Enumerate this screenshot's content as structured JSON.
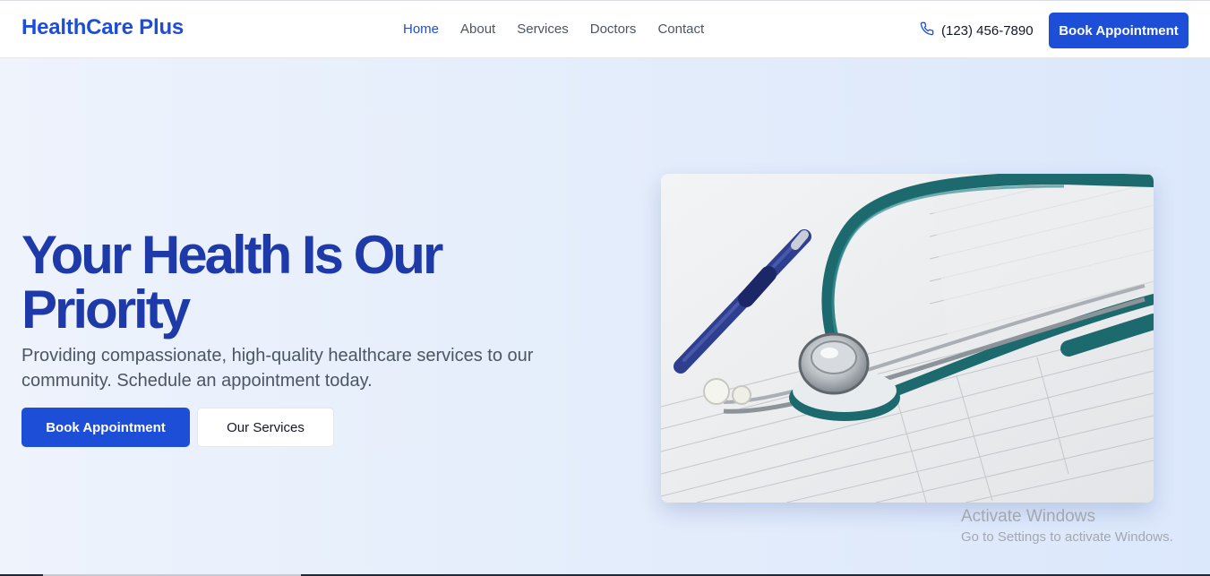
{
  "brand": {
    "name": "HealthCare Plus"
  },
  "nav": {
    "links": [
      {
        "label": "Home",
        "active": true
      },
      {
        "label": "About",
        "active": false
      },
      {
        "label": "Services",
        "active": false
      },
      {
        "label": "Doctors",
        "active": false
      },
      {
        "label": "Contact",
        "active": false
      }
    ],
    "phone": "(123) 456-7890",
    "phone_icon": "phone-icon",
    "cta_label": "Book Appointment"
  },
  "hero": {
    "title": "Your Health Is Our Priority",
    "subtitle": "Providing compassionate, high-quality healthcare services to our community. Schedule an appointment today.",
    "primary_label": "Book Appointment",
    "secondary_label": "Our Services",
    "image": "stethoscope-and-pen-on-medical-form"
  },
  "watermark": {
    "title": "Activate Windows",
    "subtitle": "Go to Settings to activate Windows."
  },
  "colors": {
    "accent": "#1d4ed8",
    "heading": "#1e3aa8",
    "background": "#e4edfb"
  }
}
